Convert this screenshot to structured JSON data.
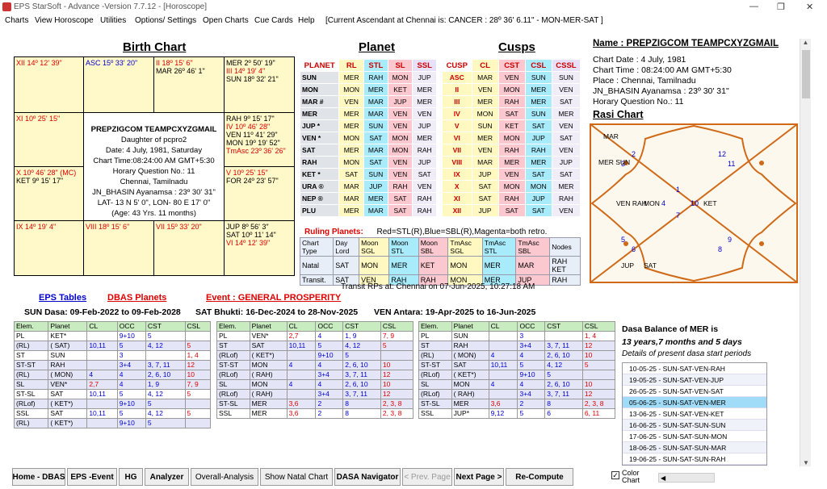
{
  "window": {
    "title": "EPS StarSoft - Advance -Version 7.7.12 - [Horoscope]"
  },
  "menu": [
    "Charts",
    "View Horoscope",
    "Utilities",
    "Options/ Settings",
    "Open Charts",
    "Cue Cards",
    "Help",
    "[Current Ascendant at Chennai is: CANCER  : 28º 36'  6.11\"   - MON-MER-SAT ]"
  ],
  "headers": {
    "birth": "Birth Chart",
    "planet": "Planet",
    "cusps": "Cusps",
    "rasi": "Rasi  Chart"
  },
  "birth_chart": {
    "c_xii": "XII  14º 12' 39\"",
    "c_asc": "ASC   15º 33' 20\"",
    "c_ii_a": "II   18º 15' 6\"",
    "c_ii_b": "MAR   26º 46' 1\"",
    "c_tr": [
      "MER  2º 50' 19\"",
      "III  14º 19' 4\"",
      "SUN  18º 32' 21\""
    ],
    "c_xi": "XI   10º 25' 15\"",
    "c_r2": [
      "RAH  9º 15' 17\"",
      "IV  10º 46' 28\"",
      "VEN  11º 41' 29\"",
      "MON  19º 19' 52\"",
      "TmAsc  23º 36' 26\""
    ],
    "c_x": [
      "X  10º 46' 28\" (MC)",
      "KET  9º 15' 17\""
    ],
    "c_v": [
      "V  10º 25' 15\"",
      "FOR  24º 23' 57\""
    ],
    "c_ix": "IX  14º 19' 4\"",
    "c_viii": "VIII  18º 15' 6\"",
    "c_vii": "VII  15º 33' 20\"",
    "c_br": [
      "JUP  8º 56' 3\"",
      "SAT  10º 11' 14\"",
      "VI   14º 12' 39\""
    ],
    "center": [
      "PREPZIGCOM   TEAMPCXYZGMAIL",
      "Daughter of  pcpro2",
      "Date: 4 July, 1981, Saturday",
      "Chart Time:08:24:00 AM GMT+5:30",
      "Horary Question No.:  11",
      "Chennai, Tamilnadu",
      "JN_BHASIN Ayanamsa : 23º 30' 31\"",
      "LAT- 13 N 5' 0\", LON- 80 E 17' 0\"",
      "(Age: 43 Yrs.  11 months)"
    ]
  },
  "planet_table": {
    "headers": [
      "PLANET",
      "RL",
      "STL",
      "SL",
      "SSL"
    ],
    "rows": [
      [
        "SUN",
        "MER",
        "RAH",
        "MON",
        "JUP"
      ],
      [
        "MON",
        "MON",
        "MER",
        "KET",
        "MER"
      ],
      [
        "MAR #",
        "VEN",
        "MAR",
        "JUP",
        "MER"
      ],
      [
        "MER",
        "MER",
        "MAR",
        "VEN",
        "VEN"
      ],
      [
        "JUP  *",
        "MER",
        "SUN",
        "VEN",
        "JUP"
      ],
      [
        "VEN  *",
        "MON",
        "SAT",
        "MON",
        "MER"
      ],
      [
        "SAT",
        "MER",
        "MAR",
        "MON",
        "RAH"
      ],
      [
        "RAH",
        "MON",
        "SAT",
        "VEN",
        "JUP"
      ],
      [
        "KET  *",
        "SAT",
        "SUN",
        "VEN",
        "SAT"
      ],
      [
        "URA  ®",
        "MAR",
        "JUP",
        "RAH",
        "VEN"
      ],
      [
        "NEP  ®",
        "MAR",
        "MER",
        "SAT",
        "RAH"
      ],
      [
        "PLU",
        "MER",
        "MAR",
        "SAT",
        "RAH"
      ]
    ]
  },
  "cusp_table": {
    "headers": [
      "CUSP",
      "CL",
      "CST",
      "CSL",
      "CSSL"
    ],
    "rows": [
      [
        "ASC",
        "MAR",
        "VEN",
        "SUN",
        "SUN"
      ],
      [
        "II",
        "VEN",
        "MON",
        "MER",
        "VEN"
      ],
      [
        "III",
        "MER",
        "RAH",
        "MER",
        "SAT"
      ],
      [
        "IV",
        "MON",
        "SAT",
        "SUN",
        "MER"
      ],
      [
        "V",
        "SUN",
        "KET",
        "SAT",
        "VEN"
      ],
      [
        "VI",
        "MER",
        "MON",
        "JUP",
        "SAT"
      ],
      [
        "VII",
        "VEN",
        "RAH",
        "RAH",
        "VEN"
      ],
      [
        "VIII",
        "MAR",
        "MER",
        "MER",
        "JUP"
      ],
      [
        "IX",
        "JUP",
        "VEN",
        "SAT",
        "SAT"
      ],
      [
        "X",
        "SAT",
        "MON",
        "MON",
        "MER"
      ],
      [
        "XI",
        "SAT",
        "RAH",
        "JUP",
        "RAH"
      ],
      [
        "XII",
        "JUP",
        "SAT",
        "SAT",
        "VEN"
      ]
    ]
  },
  "ruling": {
    "label": "Ruling Planets:",
    "note": "Red=STL(R),Blue=SBL(R),Magenta=both retro.",
    "headers": [
      "Chart Type",
      "Day Lord",
      "Moon SGL",
      "Moon STL",
      "Moon SBL",
      "TmAsc SGL",
      "TmAsc STL",
      "TmAsc SBL",
      "Nodes"
    ],
    "rows": [
      [
        "Natal",
        "SAT",
        "MON",
        "MER",
        "KET",
        "MON",
        "MER",
        "MAR",
        "RAH KET"
      ],
      [
        "Transit.",
        "SAT",
        "VEN",
        "RAH",
        "RAH",
        "MON",
        "MER",
        "JUP",
        "RAH"
      ]
    ],
    "footer": "Transit RPs at: Chennai on 07-Jun-2025, 10:27:18 AM"
  },
  "profile": {
    "name": "Name : PREPZIGCOM   TEAMPCXYZGMAIL",
    "lines": [
      "Chart Date : 4 July, 1981",
      "Chart Time : 08:24:00 AM GMT+5:30",
      "Place : Chennai, Tamilnadu",
      "JN_BHASIN Ayanamsa : 23º 30' 31\"",
      "Horary Question No.:  11"
    ]
  },
  "rasi": {
    "houses": [
      "1",
      "2",
      "3",
      "4",
      "5",
      "6",
      "7",
      "8",
      "9",
      "10",
      "11",
      "12"
    ],
    "planets": [
      "MAR",
      "MER SUN",
      "VEN RAH",
      "MON",
      "KET",
      "JUP",
      "SAT"
    ]
  },
  "links": {
    "eps": "EPS Tables",
    "dbas": "DBAS Planets",
    "event": "Event : GENERAL PROSPERITY"
  },
  "dasa": {
    "sun": "SUN Dasa: 09-Feb-2022 to 09-Feb-2028",
    "sat": "SAT Bhukti: 16-Dec-2024 to 28-Nov-2025",
    "ven": "VEN Antara: 19-Apr-2025 to 16-Jun-2025"
  },
  "elem_headers": [
    "Elem.",
    "Planet",
    "CL",
    "OCC",
    "CST",
    "CSL"
  ],
  "elem1": [
    [
      "PL",
      "KET*",
      "",
      "9+10",
      "5",
      ""
    ],
    [
      "(RL)",
      "( SAT)",
      "10,11",
      "5",
      "4, 12",
      "5"
    ],
    [
      "ST",
      "SUN",
      "",
      "3",
      "",
      "1, 4"
    ],
    [
      "ST-ST",
      "RAH",
      "",
      "3+4",
      "3, 7, 11",
      "12"
    ],
    [
      "(RL)",
      "( MON)",
      "4",
      "4",
      "2, 6, 10",
      "10"
    ],
    [
      "SL",
      "VEN*",
      "2,7",
      "4",
      "1, 9",
      "7, 9"
    ],
    [
      "ST-SL",
      "SAT",
      "10,11",
      "5",
      "4, 12",
      "5"
    ],
    [
      "(RLof)",
      "( KET*)",
      "",
      "9+10",
      "5",
      ""
    ],
    [
      "SSL",
      "SAT",
      "10,11",
      "5",
      "4, 12",
      "5"
    ],
    [
      "(RL)",
      "( KET*)",
      "",
      "9+10",
      "5",
      ""
    ]
  ],
  "elem2": [
    [
      "PL",
      "VEN*",
      "2,7",
      "4",
      "1, 9",
      "7, 9"
    ],
    [
      "ST",
      "SAT",
      "10,11",
      "5",
      "4, 12",
      "5"
    ],
    [
      "(RLof)",
      "( KET*)",
      "",
      "9+10",
      "5",
      ""
    ],
    [
      "ST-ST",
      "MON",
      "4",
      "4",
      "2, 6, 10",
      "10"
    ],
    [
      "(RLof)",
      "( RAH)",
      "",
      "3+4",
      "3, 7, 11",
      "12"
    ],
    [
      "SL",
      "MON",
      "4",
      "4",
      "2, 6, 10",
      "10"
    ],
    [
      "(RLof)",
      "( RAH)",
      "",
      "3+4",
      "3, 7, 11",
      "12"
    ],
    [
      "ST-SL",
      "MER",
      "3,6",
      "2",
      "8",
      "2, 3, 8"
    ],
    [
      "SSL",
      "MER",
      "3,6",
      "2",
      "8",
      "2, 3, 8"
    ]
  ],
  "elem3": [
    [
      "PL",
      "SUN",
      "",
      "3",
      "",
      "1, 4"
    ],
    [
      "ST",
      "RAH",
      "",
      "3+4",
      "3, 7, 11",
      "12"
    ],
    [
      "(RL)",
      "( MON)",
      "4",
      "4",
      "2, 6, 10",
      "10"
    ],
    [
      "ST-ST",
      "SAT",
      "10,11",
      "5",
      "4, 12",
      "5"
    ],
    [
      "(RLof)",
      "( KET*)",
      "",
      "9+10",
      "5",
      ""
    ],
    [
      "SL",
      "MON",
      "4",
      "4",
      "2, 6, 10",
      "10"
    ],
    [
      "(RLof)",
      "( RAH)",
      "",
      "3+4",
      "3, 7, 11",
      "12"
    ],
    [
      "ST-SL",
      "MER",
      "3,6",
      "2",
      "8",
      "2, 3, 8"
    ],
    [
      "SSL",
      "JUP*",
      "9,12",
      "5",
      "6",
      "6, 11"
    ]
  ],
  "dasa_balance": {
    "l1": "Dasa Balance of MER is",
    "l2": "13 years,7 months and  5 days",
    "l3": "Details of present dasa start periods",
    "items": [
      "10-05-25    - SUN-SAT-VEN-RAH",
      "19-05-25    - SUN-SAT-VEN-JUP",
      "26-05-25    - SUN-SAT-VEN-SAT",
      "05-06-25    - SUN-SAT-VEN-MER",
      "13-06-25    - SUN-SAT-VEN-KET",
      "16-06-25    - SUN-SAT-SUN-SUN",
      "17-06-25    - SUN-SAT-SUN-MON",
      "18-06-25    - SUN-SAT-SUN-MAR",
      "19-06-25    - SUN-SAT-SUN-RAH"
    ]
  },
  "buttons": [
    "Home - DBAS",
    "EPS -Event",
    "HG",
    "Analyzer",
    "Overall-Analysis",
    "Show Natal Chart",
    "DASA Navigator",
    "< Prev. Page",
    "Next Page >",
    "Re-Compute"
  ],
  "color_chart": "Color Chart",
  "colors": {
    "cyan": "#a8ecfc",
    "pink": "#fcc8d0",
    "rasi_bg": "#fdf8ee",
    "rasi_line": "#d06a18"
  }
}
